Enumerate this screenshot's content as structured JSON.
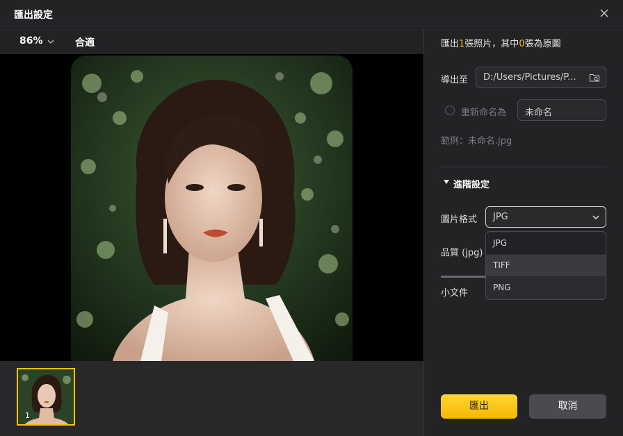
{
  "window": {
    "title": "匯出設定"
  },
  "preview": {
    "zoom": "86%",
    "fit_label": "合適",
    "thumbnail_index": "1"
  },
  "settings": {
    "summary": {
      "pre": "匯出",
      "count": "1",
      "mid": "張照片，其中",
      "original_count": "0",
      "post": "張為原圖"
    },
    "export_to_label": "導出至",
    "export_path": "D:/Users/Pictures/P...",
    "rename_label": "重新命名為",
    "rename_value": "未命名",
    "example_text": "範例：未命名.jpg",
    "advanced_label": "進階設定",
    "format_label": "圖片格式",
    "format_value": "JPG",
    "format_options": [
      "JPG",
      "TIFF",
      "PNG"
    ],
    "quality_label": "品質 (jpg)",
    "small_file_label": "小文件"
  },
  "buttons": {
    "export": "匯出",
    "cancel": "取消"
  },
  "colors": {
    "accent": "#f2c300",
    "background": "#232326",
    "canvas": "#000000"
  }
}
